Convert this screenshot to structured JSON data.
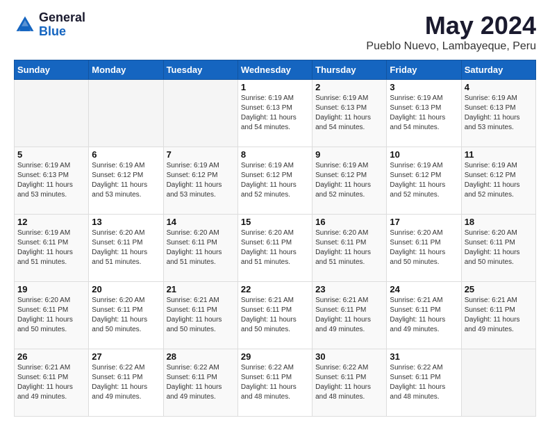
{
  "logo": {
    "general": "General",
    "blue": "Blue"
  },
  "header": {
    "title": "May 2024",
    "subtitle": "Pueblo Nuevo, Lambayeque, Peru"
  },
  "days_of_week": [
    "Sunday",
    "Monday",
    "Tuesday",
    "Wednesday",
    "Thursday",
    "Friday",
    "Saturday"
  ],
  "weeks": [
    [
      {
        "day": "",
        "sunrise": "",
        "sunset": "",
        "daylight": "",
        "empty": true
      },
      {
        "day": "",
        "sunrise": "",
        "sunset": "",
        "daylight": "",
        "empty": true
      },
      {
        "day": "",
        "sunrise": "",
        "sunset": "",
        "daylight": "",
        "empty": true
      },
      {
        "day": "1",
        "sunrise": "Sunrise: 6:19 AM",
        "sunset": "Sunset: 6:13 PM",
        "daylight": "Daylight: 11 hours and 54 minutes.",
        "empty": false
      },
      {
        "day": "2",
        "sunrise": "Sunrise: 6:19 AM",
        "sunset": "Sunset: 6:13 PM",
        "daylight": "Daylight: 11 hours and 54 minutes.",
        "empty": false
      },
      {
        "day": "3",
        "sunrise": "Sunrise: 6:19 AM",
        "sunset": "Sunset: 6:13 PM",
        "daylight": "Daylight: 11 hours and 54 minutes.",
        "empty": false
      },
      {
        "day": "4",
        "sunrise": "Sunrise: 6:19 AM",
        "sunset": "Sunset: 6:13 PM",
        "daylight": "Daylight: 11 hours and 53 minutes.",
        "empty": false
      }
    ],
    [
      {
        "day": "5",
        "sunrise": "Sunrise: 6:19 AM",
        "sunset": "Sunset: 6:13 PM",
        "daylight": "Daylight: 11 hours and 53 minutes.",
        "empty": false
      },
      {
        "day": "6",
        "sunrise": "Sunrise: 6:19 AM",
        "sunset": "Sunset: 6:12 PM",
        "daylight": "Daylight: 11 hours and 53 minutes.",
        "empty": false
      },
      {
        "day": "7",
        "sunrise": "Sunrise: 6:19 AM",
        "sunset": "Sunset: 6:12 PM",
        "daylight": "Daylight: 11 hours and 53 minutes.",
        "empty": false
      },
      {
        "day": "8",
        "sunrise": "Sunrise: 6:19 AM",
        "sunset": "Sunset: 6:12 PM",
        "daylight": "Daylight: 11 hours and 52 minutes.",
        "empty": false
      },
      {
        "day": "9",
        "sunrise": "Sunrise: 6:19 AM",
        "sunset": "Sunset: 6:12 PM",
        "daylight": "Daylight: 11 hours and 52 minutes.",
        "empty": false
      },
      {
        "day": "10",
        "sunrise": "Sunrise: 6:19 AM",
        "sunset": "Sunset: 6:12 PM",
        "daylight": "Daylight: 11 hours and 52 minutes.",
        "empty": false
      },
      {
        "day": "11",
        "sunrise": "Sunrise: 6:19 AM",
        "sunset": "Sunset: 6:12 PM",
        "daylight": "Daylight: 11 hours and 52 minutes.",
        "empty": false
      }
    ],
    [
      {
        "day": "12",
        "sunrise": "Sunrise: 6:19 AM",
        "sunset": "Sunset: 6:11 PM",
        "daylight": "Daylight: 11 hours and 51 minutes.",
        "empty": false
      },
      {
        "day": "13",
        "sunrise": "Sunrise: 6:20 AM",
        "sunset": "Sunset: 6:11 PM",
        "daylight": "Daylight: 11 hours and 51 minutes.",
        "empty": false
      },
      {
        "day": "14",
        "sunrise": "Sunrise: 6:20 AM",
        "sunset": "Sunset: 6:11 PM",
        "daylight": "Daylight: 11 hours and 51 minutes.",
        "empty": false
      },
      {
        "day": "15",
        "sunrise": "Sunrise: 6:20 AM",
        "sunset": "Sunset: 6:11 PM",
        "daylight": "Daylight: 11 hours and 51 minutes.",
        "empty": false
      },
      {
        "day": "16",
        "sunrise": "Sunrise: 6:20 AM",
        "sunset": "Sunset: 6:11 PM",
        "daylight": "Daylight: 11 hours and 51 minutes.",
        "empty": false
      },
      {
        "day": "17",
        "sunrise": "Sunrise: 6:20 AM",
        "sunset": "Sunset: 6:11 PM",
        "daylight": "Daylight: 11 hours and 50 minutes.",
        "empty": false
      },
      {
        "day": "18",
        "sunrise": "Sunrise: 6:20 AM",
        "sunset": "Sunset: 6:11 PM",
        "daylight": "Daylight: 11 hours and 50 minutes.",
        "empty": false
      }
    ],
    [
      {
        "day": "19",
        "sunrise": "Sunrise: 6:20 AM",
        "sunset": "Sunset: 6:11 PM",
        "daylight": "Daylight: 11 hours and 50 minutes.",
        "empty": false
      },
      {
        "day": "20",
        "sunrise": "Sunrise: 6:20 AM",
        "sunset": "Sunset: 6:11 PM",
        "daylight": "Daylight: 11 hours and 50 minutes.",
        "empty": false
      },
      {
        "day": "21",
        "sunrise": "Sunrise: 6:21 AM",
        "sunset": "Sunset: 6:11 PM",
        "daylight": "Daylight: 11 hours and 50 minutes.",
        "empty": false
      },
      {
        "day": "22",
        "sunrise": "Sunrise: 6:21 AM",
        "sunset": "Sunset: 6:11 PM",
        "daylight": "Daylight: 11 hours and 50 minutes.",
        "empty": false
      },
      {
        "day": "23",
        "sunrise": "Sunrise: 6:21 AM",
        "sunset": "Sunset: 6:11 PM",
        "daylight": "Daylight: 11 hours and 49 minutes.",
        "empty": false
      },
      {
        "day": "24",
        "sunrise": "Sunrise: 6:21 AM",
        "sunset": "Sunset: 6:11 PM",
        "daylight": "Daylight: 11 hours and 49 minutes.",
        "empty": false
      },
      {
        "day": "25",
        "sunrise": "Sunrise: 6:21 AM",
        "sunset": "Sunset: 6:11 PM",
        "daylight": "Daylight: 11 hours and 49 minutes.",
        "empty": false
      }
    ],
    [
      {
        "day": "26",
        "sunrise": "Sunrise: 6:21 AM",
        "sunset": "Sunset: 6:11 PM",
        "daylight": "Daylight: 11 hours and 49 minutes.",
        "empty": false
      },
      {
        "day": "27",
        "sunrise": "Sunrise: 6:22 AM",
        "sunset": "Sunset: 6:11 PM",
        "daylight": "Daylight: 11 hours and 49 minutes.",
        "empty": false
      },
      {
        "day": "28",
        "sunrise": "Sunrise: 6:22 AM",
        "sunset": "Sunset: 6:11 PM",
        "daylight": "Daylight: 11 hours and 49 minutes.",
        "empty": false
      },
      {
        "day": "29",
        "sunrise": "Sunrise: 6:22 AM",
        "sunset": "Sunset: 6:11 PM",
        "daylight": "Daylight: 11 hours and 48 minutes.",
        "empty": false
      },
      {
        "day": "30",
        "sunrise": "Sunrise: 6:22 AM",
        "sunset": "Sunset: 6:11 PM",
        "daylight": "Daylight: 11 hours and 48 minutes.",
        "empty": false
      },
      {
        "day": "31",
        "sunrise": "Sunrise: 6:22 AM",
        "sunset": "Sunset: 6:11 PM",
        "daylight": "Daylight: 11 hours and 48 minutes.",
        "empty": false
      },
      {
        "day": "",
        "sunrise": "",
        "sunset": "",
        "daylight": "",
        "empty": true
      }
    ]
  ]
}
